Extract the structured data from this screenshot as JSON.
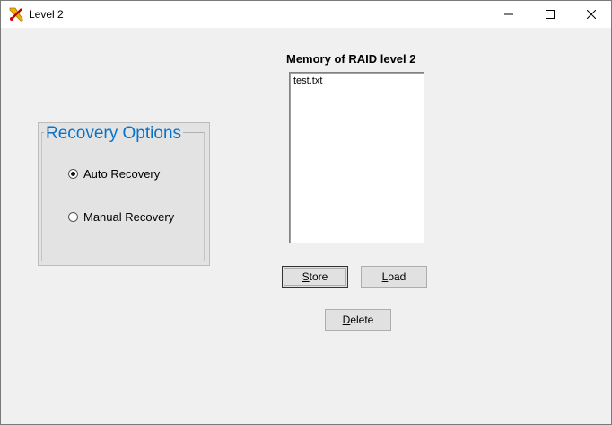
{
  "window": {
    "title": "Level 2",
    "icon": "raid-app-icon"
  },
  "recovery": {
    "title": "Recovery Options",
    "options": [
      {
        "label": "Auto Recovery",
        "selected": true
      },
      {
        "label": "Manual Recovery",
        "selected": false
      }
    ]
  },
  "memory": {
    "label": "Memory of RAID level 2",
    "items": [
      "test.txt"
    ]
  },
  "buttons": {
    "store": "Store",
    "load": "Load",
    "delete": "Delete"
  }
}
